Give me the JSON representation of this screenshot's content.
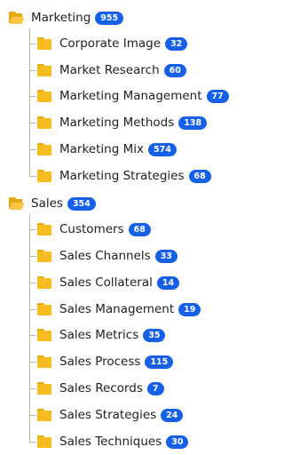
{
  "colors": {
    "badge": "#1660e5",
    "folder": "#f5bd1f",
    "connector": "#b5b5b5"
  },
  "tree": [
    {
      "label": "Marketing",
      "count": "955",
      "icon": "folder-open-icon",
      "children": [
        {
          "label": "Corporate Image",
          "count": "32",
          "icon": "folder-icon"
        },
        {
          "label": "Market Research",
          "count": "60",
          "icon": "folder-icon"
        },
        {
          "label": "Marketing Management",
          "count": "77",
          "icon": "folder-icon"
        },
        {
          "label": "Marketing Methods",
          "count": "138",
          "icon": "folder-icon"
        },
        {
          "label": "Marketing Mix",
          "count": "574",
          "icon": "folder-icon"
        },
        {
          "label": "Marketing Strategies",
          "count": "68",
          "icon": "folder-icon"
        }
      ]
    },
    {
      "label": "Sales",
      "count": "354",
      "icon": "folder-open-icon",
      "children": [
        {
          "label": "Customers",
          "count": "68",
          "icon": "folder-icon"
        },
        {
          "label": "Sales Channels",
          "count": "33",
          "icon": "folder-icon"
        },
        {
          "label": "Sales Collateral",
          "count": "14",
          "icon": "folder-icon"
        },
        {
          "label": "Sales Management",
          "count": "19",
          "icon": "folder-icon"
        },
        {
          "label": "Sales Metrics",
          "count": "35",
          "icon": "folder-icon"
        },
        {
          "label": "Sales Process",
          "count": "115",
          "icon": "folder-icon"
        },
        {
          "label": "Sales Records",
          "count": "7",
          "icon": "folder-icon"
        },
        {
          "label": "Sales Strategies",
          "count": "24",
          "icon": "folder-icon"
        },
        {
          "label": "Sales Techniques",
          "count": "30",
          "icon": "folder-icon"
        }
      ]
    }
  ]
}
